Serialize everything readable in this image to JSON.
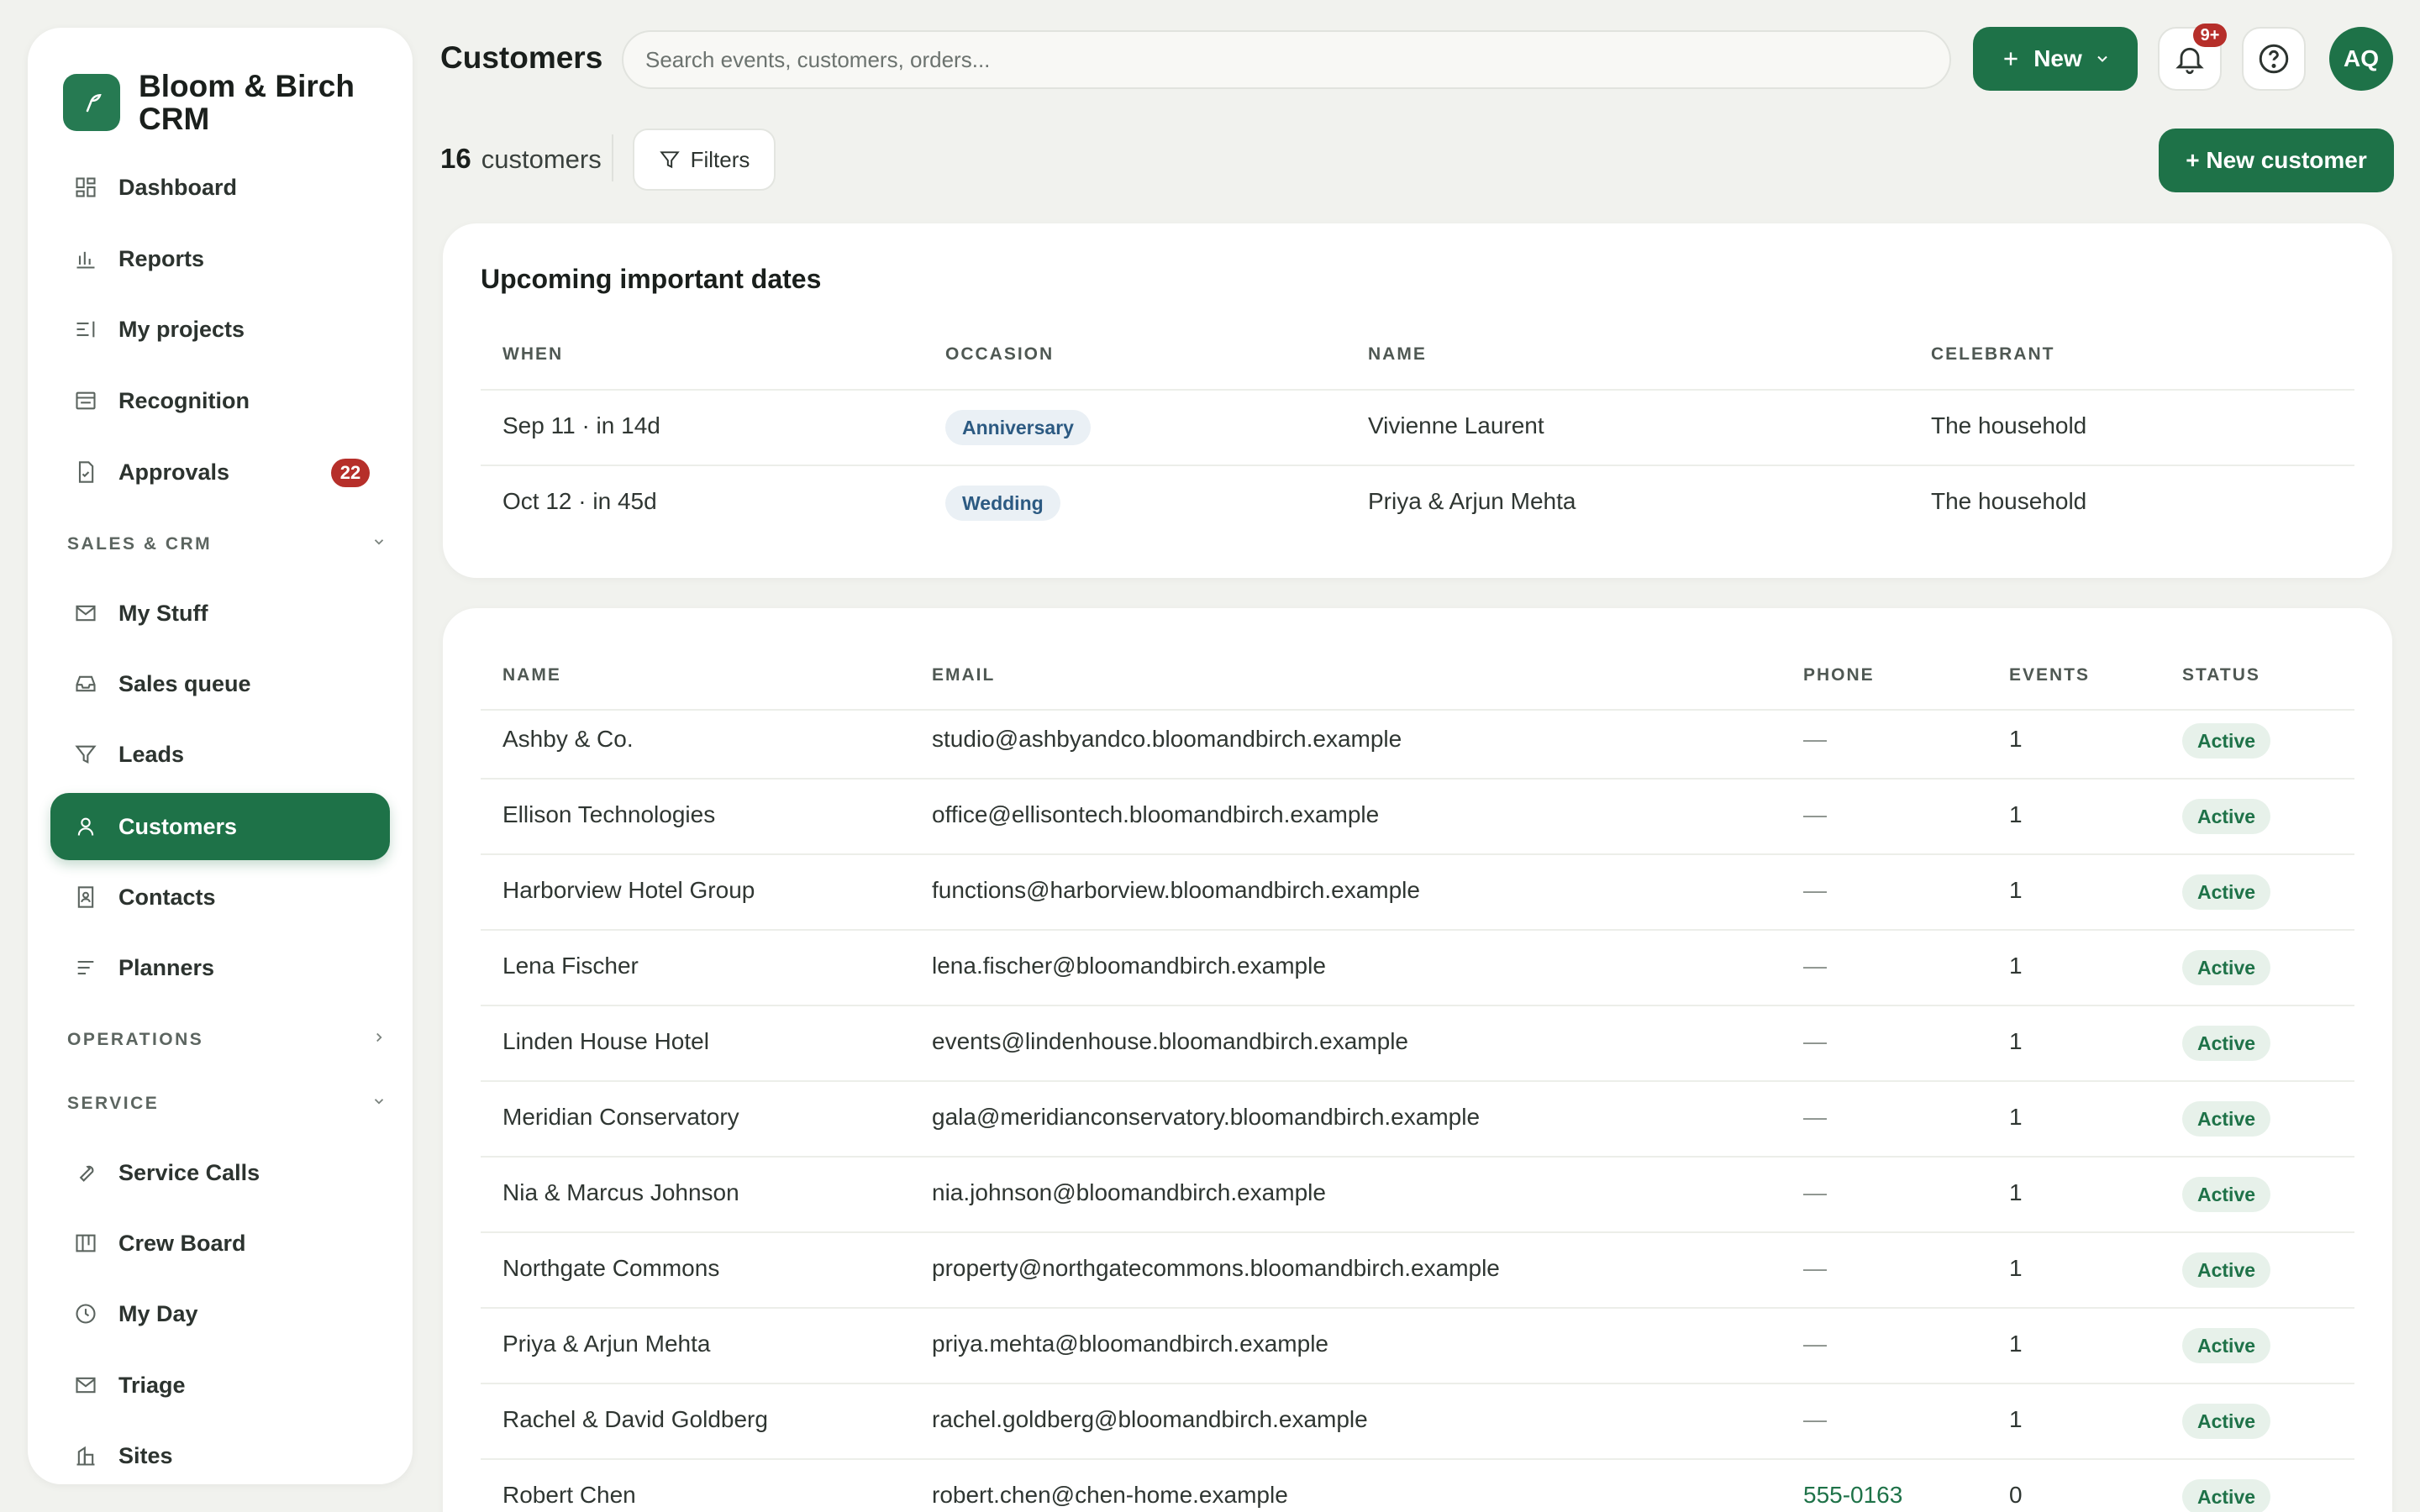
{
  "brand": {
    "name": "Bloom & Birch CRM"
  },
  "sidebar": {
    "items": [
      {
        "label": "Dashboard",
        "icon": "dashboard-icon"
      },
      {
        "label": "Reports",
        "icon": "bar-chart-icon"
      },
      {
        "label": "My projects",
        "icon": "list-icon"
      },
      {
        "label": "Recognition",
        "icon": "card-icon"
      },
      {
        "label": "Approvals",
        "icon": "document-check-icon",
        "badge": "22"
      }
    ],
    "sections": [
      {
        "label": "SALES & CRM",
        "expanded": true,
        "items": [
          {
            "label": "My Stuff",
            "icon": "mail-icon"
          },
          {
            "label": "Sales queue",
            "icon": "inbox-icon"
          },
          {
            "label": "Leads",
            "icon": "filter-icon"
          },
          {
            "label": "Customers",
            "icon": "user-icon",
            "active": true
          },
          {
            "label": "Contacts",
            "icon": "contacts-icon"
          },
          {
            "label": "Planners",
            "icon": "lines-icon"
          }
        ]
      },
      {
        "label": "OPERATIONS",
        "expanded": false,
        "items": []
      },
      {
        "label": "SERVICE",
        "expanded": true,
        "items": [
          {
            "label": "Service Calls",
            "icon": "wrench-icon"
          },
          {
            "label": "Crew Board",
            "icon": "board-icon"
          },
          {
            "label": "My Day",
            "icon": "clock-icon"
          },
          {
            "label": "Triage",
            "icon": "mail-icon"
          },
          {
            "label": "Sites",
            "icon": "building-icon"
          }
        ]
      }
    ]
  },
  "header": {
    "title": "Customers",
    "search_placeholder": "Search events, customers, orders...",
    "new_label": "New",
    "notifications_badge": "9+",
    "avatar_initials": "AQ"
  },
  "toolbar": {
    "count": "16",
    "count_label": "customers",
    "filters_label": "Filters",
    "new_customer_label": "+ New customer"
  },
  "upcoming": {
    "title": "Upcoming important dates",
    "columns": [
      "WHEN",
      "OCCASION",
      "NAME",
      "CELEBRANT"
    ],
    "rows": [
      {
        "when": "Sep 11 · in 14d",
        "occasion": "Anniversary",
        "name": "Vivienne Laurent",
        "celebrant": "The household"
      },
      {
        "when": "Oct 12 · in 45d",
        "occasion": "Wedding",
        "name": "Priya & Arjun Mehta",
        "celebrant": "The household"
      }
    ]
  },
  "customers": {
    "columns": [
      "NAME",
      "EMAIL",
      "PHONE",
      "EVENTS",
      "STATUS"
    ],
    "rows": [
      {
        "name": "Ashby & Co.",
        "email": "studio@ashbyandco.bloomandbirch.example",
        "phone": "—",
        "events": "1",
        "status": "Active"
      },
      {
        "name": "Ellison Technologies",
        "email": "office@ellisontech.bloomandbirch.example",
        "phone": "—",
        "events": "1",
        "status": "Active"
      },
      {
        "name": "Harborview Hotel Group",
        "email": "functions@harborview.bloomandbirch.example",
        "phone": "—",
        "events": "1",
        "status": "Active"
      },
      {
        "name": "Lena Fischer",
        "email": "lena.fischer@bloomandbirch.example",
        "phone": "—",
        "events": "1",
        "status": "Active"
      },
      {
        "name": "Linden House Hotel",
        "email": "events@lindenhouse.bloomandbirch.example",
        "phone": "—",
        "events": "1",
        "status": "Active"
      },
      {
        "name": "Meridian Conservatory",
        "email": "gala@meridianconservatory.bloomandbirch.example",
        "phone": "—",
        "events": "1",
        "status": "Active"
      },
      {
        "name": "Nia & Marcus Johnson",
        "email": "nia.johnson@bloomandbirch.example",
        "phone": "—",
        "events": "1",
        "status": "Active"
      },
      {
        "name": "Northgate Commons",
        "email": "property@northgatecommons.bloomandbirch.example",
        "phone": "—",
        "events": "1",
        "status": "Active"
      },
      {
        "name": "Priya & Arjun Mehta",
        "email": "priya.mehta@bloomandbirch.example",
        "phone": "—",
        "events": "1",
        "status": "Active"
      },
      {
        "name": "Rachel & David Goldberg",
        "email": "rachel.goldberg@bloomandbirch.example",
        "phone": "—",
        "events": "1",
        "status": "Active"
      },
      {
        "name": "Robert Chen",
        "email": "robert.chen@chen-home.example",
        "phone": "555-0163",
        "events": "0",
        "status": "Active"
      }
    ]
  },
  "colors": {
    "accent": "#1e7248",
    "badge": "#b62f2a",
    "background": "#f1f2ee"
  }
}
